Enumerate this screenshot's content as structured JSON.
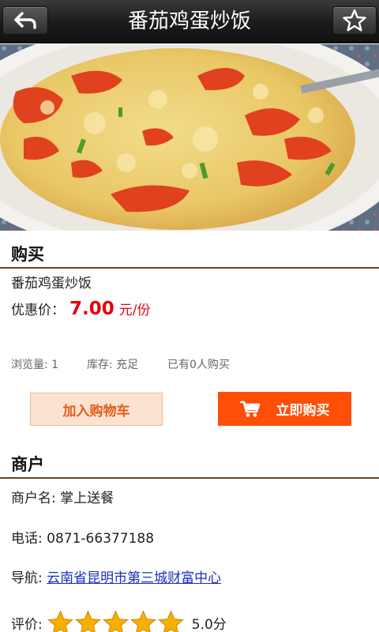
{
  "header": {
    "title": "番茄鸡蛋炒饭",
    "back_icon": "back-arrow-icon",
    "fav_icon": "star-outline-icon"
  },
  "buy": {
    "section_title": "购买",
    "product_name": "番茄鸡蛋炒饭",
    "price_label": "优惠价：",
    "price": "7.00",
    "price_unit": "元/份",
    "views": "浏览量: 1",
    "stock": "库存: 充足",
    "sold": "已有0人购买",
    "add_cart_label": "加入购物车",
    "buy_now_label": "立即购买",
    "cart_icon": "cart-icon"
  },
  "merchant": {
    "section_title": "商户",
    "name_line": "商户名: 掌上送餐",
    "phone_line": "电话: 0871-66377188",
    "nav_label": "导航: ",
    "nav_address": "云南省昆明市第三城财富中心",
    "rating_label": "评价:",
    "rating_value": "5.0分",
    "rating_stars": 5
  },
  "colors": {
    "accent_red": "#e8000b",
    "buy_orange": "#ff4e05",
    "rule_brown": "#6b4226",
    "star_gold": "#f5b000"
  }
}
